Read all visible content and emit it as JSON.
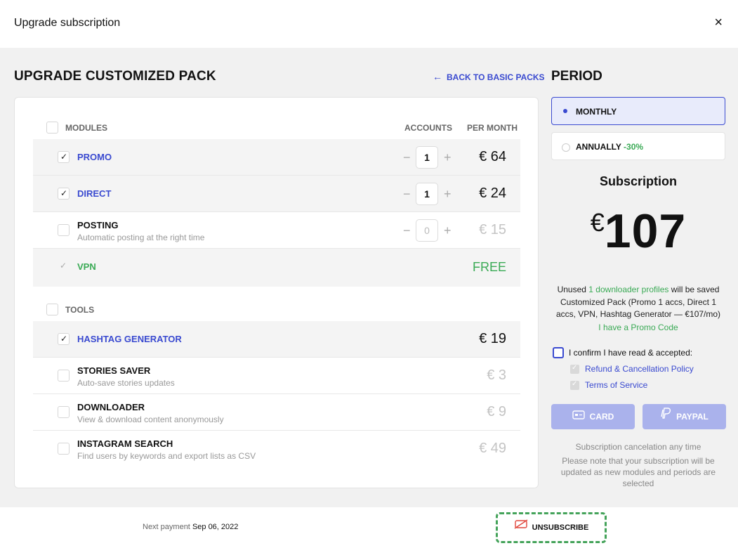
{
  "window": {
    "title": "Upgrade subscription",
    "close_label": "×"
  },
  "left": {
    "heading": "UPGRADE CUSTOMIZED PACK",
    "back_link": "BACK TO BASIC PACKS",
    "back_arrow": "←",
    "modules": {
      "label": "MODULES",
      "col_accounts": "ACCOUNTS",
      "col_per_month": "PER MONTH",
      "items": [
        {
          "name": "PROMO",
          "desc": "",
          "qty": "1",
          "price": "€ 64",
          "checked": true
        },
        {
          "name": "DIRECT",
          "desc": "",
          "qty": "1",
          "price": "€ 24",
          "checked": true
        },
        {
          "name": "POSTING",
          "desc": "Automatic posting at the right time",
          "qty": "0",
          "price": "€ 15",
          "checked": false
        },
        {
          "name": "VPN",
          "desc": "",
          "price": "FREE",
          "checked": true
        }
      ]
    },
    "tools": {
      "label": "TOOLS",
      "items": [
        {
          "name": "HASHTAG GENERATOR",
          "desc": "",
          "price": "€ 19",
          "checked": true
        },
        {
          "name": "STORIES SAVER",
          "desc": "Auto-save stories updates",
          "price": "€ 3",
          "checked": false
        },
        {
          "name": "DOWNLOADER",
          "desc": "View & download content anonymously",
          "price": "€ 9",
          "checked": false
        },
        {
          "name": "INSTAGRAM SEARCH",
          "desc": "Find users by keywords and export lists as CSV",
          "price": "€ 49",
          "checked": false
        }
      ]
    },
    "stepper": {
      "minus": "−",
      "plus": "+"
    }
  },
  "right": {
    "heading": "PERIOD",
    "monthly": "MONTHLY",
    "annually": "ANNUALLY",
    "annual_discount": "-30%",
    "subscription_title": "Subscription",
    "currency": "€",
    "amount": "107",
    "unused_prefix": "Unused",
    "unused_link": "1 downloader profiles",
    "unused_suffix": "will be saved",
    "pack_summary": "Customized Pack (Promo 1 accs, Direct 1 accs, VPN, Hashtag Generator — €107/mo)",
    "promo_code": "I have a Promo Code",
    "confirm_label": "I confirm I have read & accepted:",
    "refund_policy": "Refund & Cancellation Policy",
    "terms": "Terms of Service",
    "card_button": "CARD",
    "paypal_button": "PAYPAL",
    "cancel_note": "Subscription cancelation any time",
    "update_note": "Please note that your subscription will be updated as new modules and periods are selected"
  },
  "footer": {
    "next_payment_label": "Next payment",
    "next_payment_date": "Sep 06, 2022",
    "unsubscribe": "UNSUBSCRIBE"
  },
  "colors": {
    "accent": "#3a4ad0",
    "green": "#3aaa55",
    "button_disabled": "#aab2ec"
  },
  "icons": {
    "close": "close-icon",
    "back": "arrow-left-icon",
    "card": "card-icon",
    "paypal": "paypal-icon",
    "unsubscribe": "card-off-icon"
  }
}
